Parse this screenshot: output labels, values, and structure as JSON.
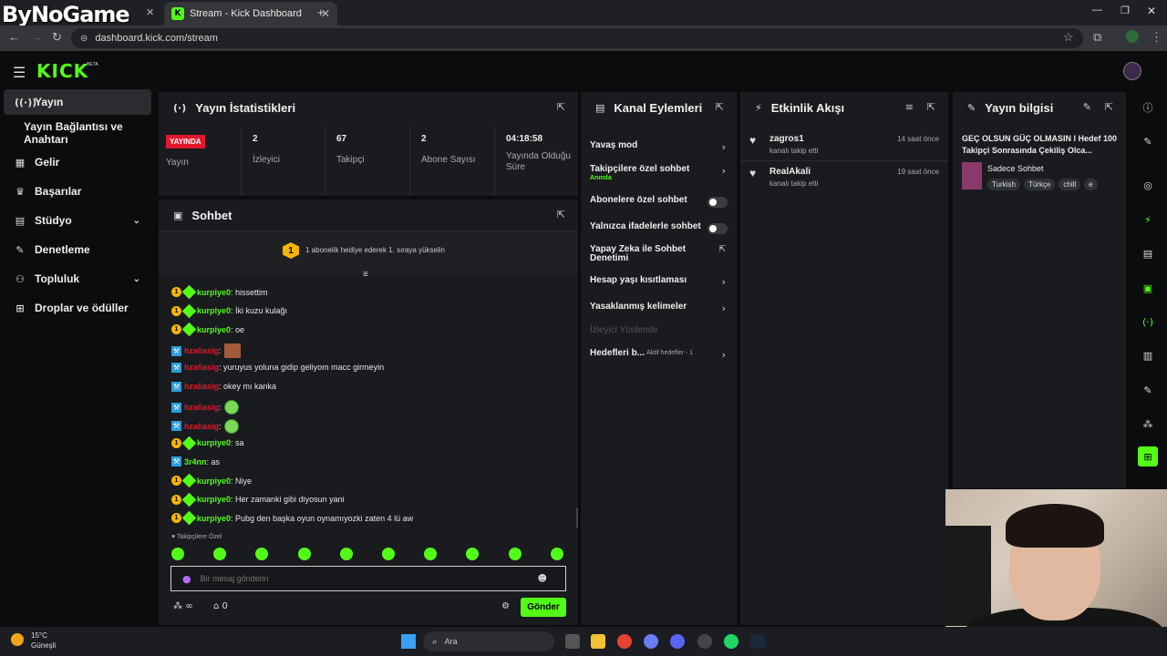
{
  "browser": {
    "watermark": "ByNoGame",
    "tab_title": "Stream - Kick Dashboard",
    "url": "dashboard.kick.com/stream"
  },
  "header": {
    "logo": "KICK",
    "beta": "BETA"
  },
  "sidebar": {
    "items": [
      {
        "label": "Yayın",
        "icon": "broadcast-icon"
      },
      {
        "label": "Yayın Bağlantısı ve Anahtarı",
        "icon": ""
      },
      {
        "label": "Gelir",
        "icon": "revenue-icon"
      },
      {
        "label": "Başarılar",
        "icon": "trophy-icon"
      },
      {
        "label": "Stüdyo",
        "icon": "studio-icon"
      },
      {
        "label": "Denetleme",
        "icon": "wrench-icon"
      },
      {
        "label": "Topluluk",
        "icon": "community-icon"
      },
      {
        "label": "Droplar ve ödüller",
        "icon": "drops-icon"
      }
    ]
  },
  "stats_panel": {
    "title": "Yayın İstatistikleri",
    "live_badge": "YAYINDA",
    "live_label": "Yayın",
    "stats": [
      {
        "value": "2",
        "label": "İzleyici"
      },
      {
        "value": "67",
        "label": "Takipçi"
      },
      {
        "value": "2",
        "label": "Abone Sayısı"
      },
      {
        "value": "04:18:58",
        "label": "Yayında Olduğu Süre"
      }
    ]
  },
  "chat_panel": {
    "title": "Sohbet",
    "gift_badge": "1",
    "gift_text": "1 abonelik hediye ederek 1. sıraya yükselin",
    "messages": [
      {
        "user": "kurpiye0",
        "text": ": hissettim",
        "color": "#53fc18",
        "badges": "sub-gift"
      },
      {
        "user": "kurpiye0",
        "text": ": İki kuzu kulağı",
        "color": "#53fc18",
        "badges": "sub-gift"
      },
      {
        "user": "kurpiye0",
        "text": ": oe",
        "color": "#53fc18",
        "badges": "sub-gift"
      },
      {
        "user": "hzaliasig",
        "text": ":",
        "color": "#e2182c",
        "badges": "mod",
        "emote": "face"
      },
      {
        "user": "hzaliasig",
        "text": ": yuruyus yoluna gidip geliyom macc girmeyin",
        "color": "#e2182c",
        "badges": "mod"
      },
      {
        "user": "hzaliasig",
        "text": ": okey mı kanka",
        "color": "#e2182c",
        "badges": "mod"
      },
      {
        "user": "hzaliasig",
        "text": ":",
        "color": "#e2182c",
        "badges": "mod",
        "emote": "green"
      },
      {
        "user": "hzaliasig",
        "text": ":",
        "color": "#e2182c",
        "badges": "mod",
        "emote": "green"
      },
      {
        "user": "kurpiye0",
        "text": ": sa",
        "color": "#53fc18",
        "badges": "sub-gift"
      },
      {
        "user": "3r4nn",
        "text": ": as",
        "color": "#53fc18",
        "badges": "mod"
      },
      {
        "user": "kurpiye0",
        "text": ": Niye",
        "color": "#53fc18",
        "badges": "sub-gift"
      },
      {
        "user": "kurpiye0",
        "text": ": Her zamanki gibi diyosun yani",
        "color": "#53fc18",
        "badges": "sub-gift"
      },
      {
        "user": "kurpiye0",
        "text": ": Pubg den başka oyun oynamıyozki zaten 4 lü aw",
        "color": "#53fc18",
        "badges": "sub-gift"
      }
    ],
    "followers_only_label": "Takipçilere Özel",
    "input_placeholder": "Bir mesaj gönderin",
    "send_label": "Gönder",
    "points_value": "∞",
    "store_value": "0"
  },
  "actions_panel": {
    "title": "Kanal Eylemleri",
    "items": [
      {
        "label": "Yavaş mod",
        "type": "chevron"
      },
      {
        "label": "Takipçilere özel sohbet",
        "sub": "Anında",
        "type": "chevron"
      },
      {
        "label": "Abonelere özel sohbet",
        "type": "toggle"
      },
      {
        "label": "Yalnızca ifadelerle sohbet",
        "type": "toggle"
      },
      {
        "label": "Yapay Zeka ile Sohbet Denetimi",
        "type": "external"
      },
      {
        "label": "Hesap yaşı kısıtlaması",
        "type": "chevron"
      },
      {
        "label": "Yasaklanmış kelimeler",
        "type": "chevron"
      },
      {
        "label": "İzleyici Yönlendir",
        "type": "disabled"
      },
      {
        "label": "Hedefleri b...",
        "sub": "Aktif hedefler - 1",
        "type": "chevron"
      }
    ]
  },
  "activity_panel": {
    "title": "Etkinlik Akışı",
    "items": [
      {
        "user": "zagros1",
        "action": "kanalı takip etti",
        "time": "14 saat önce"
      },
      {
        "user": "RealAkali",
        "action": "kanalı takip etti",
        "time": "19 saat önce"
      }
    ]
  },
  "info_panel": {
    "title": "Yayın bilgisi",
    "stream_title": "GEÇ OLSUN GÜÇ OLMASIN  l Hedef 100 Takipçi Sonrasında Çekiliş Olca...",
    "category": "Sadece Sohbet",
    "tags": [
      "Turkish",
      "Türkçe",
      "chill",
      "e"
    ]
  },
  "taskbar": {
    "weather_temp": "15°C",
    "weather_label": "Güneşli",
    "search_label": "Ara"
  },
  "colors": {
    "accent": "#53fc18",
    "live": "#e2182c",
    "panel": "#191b1f",
    "bg": "#0b0c0d"
  }
}
